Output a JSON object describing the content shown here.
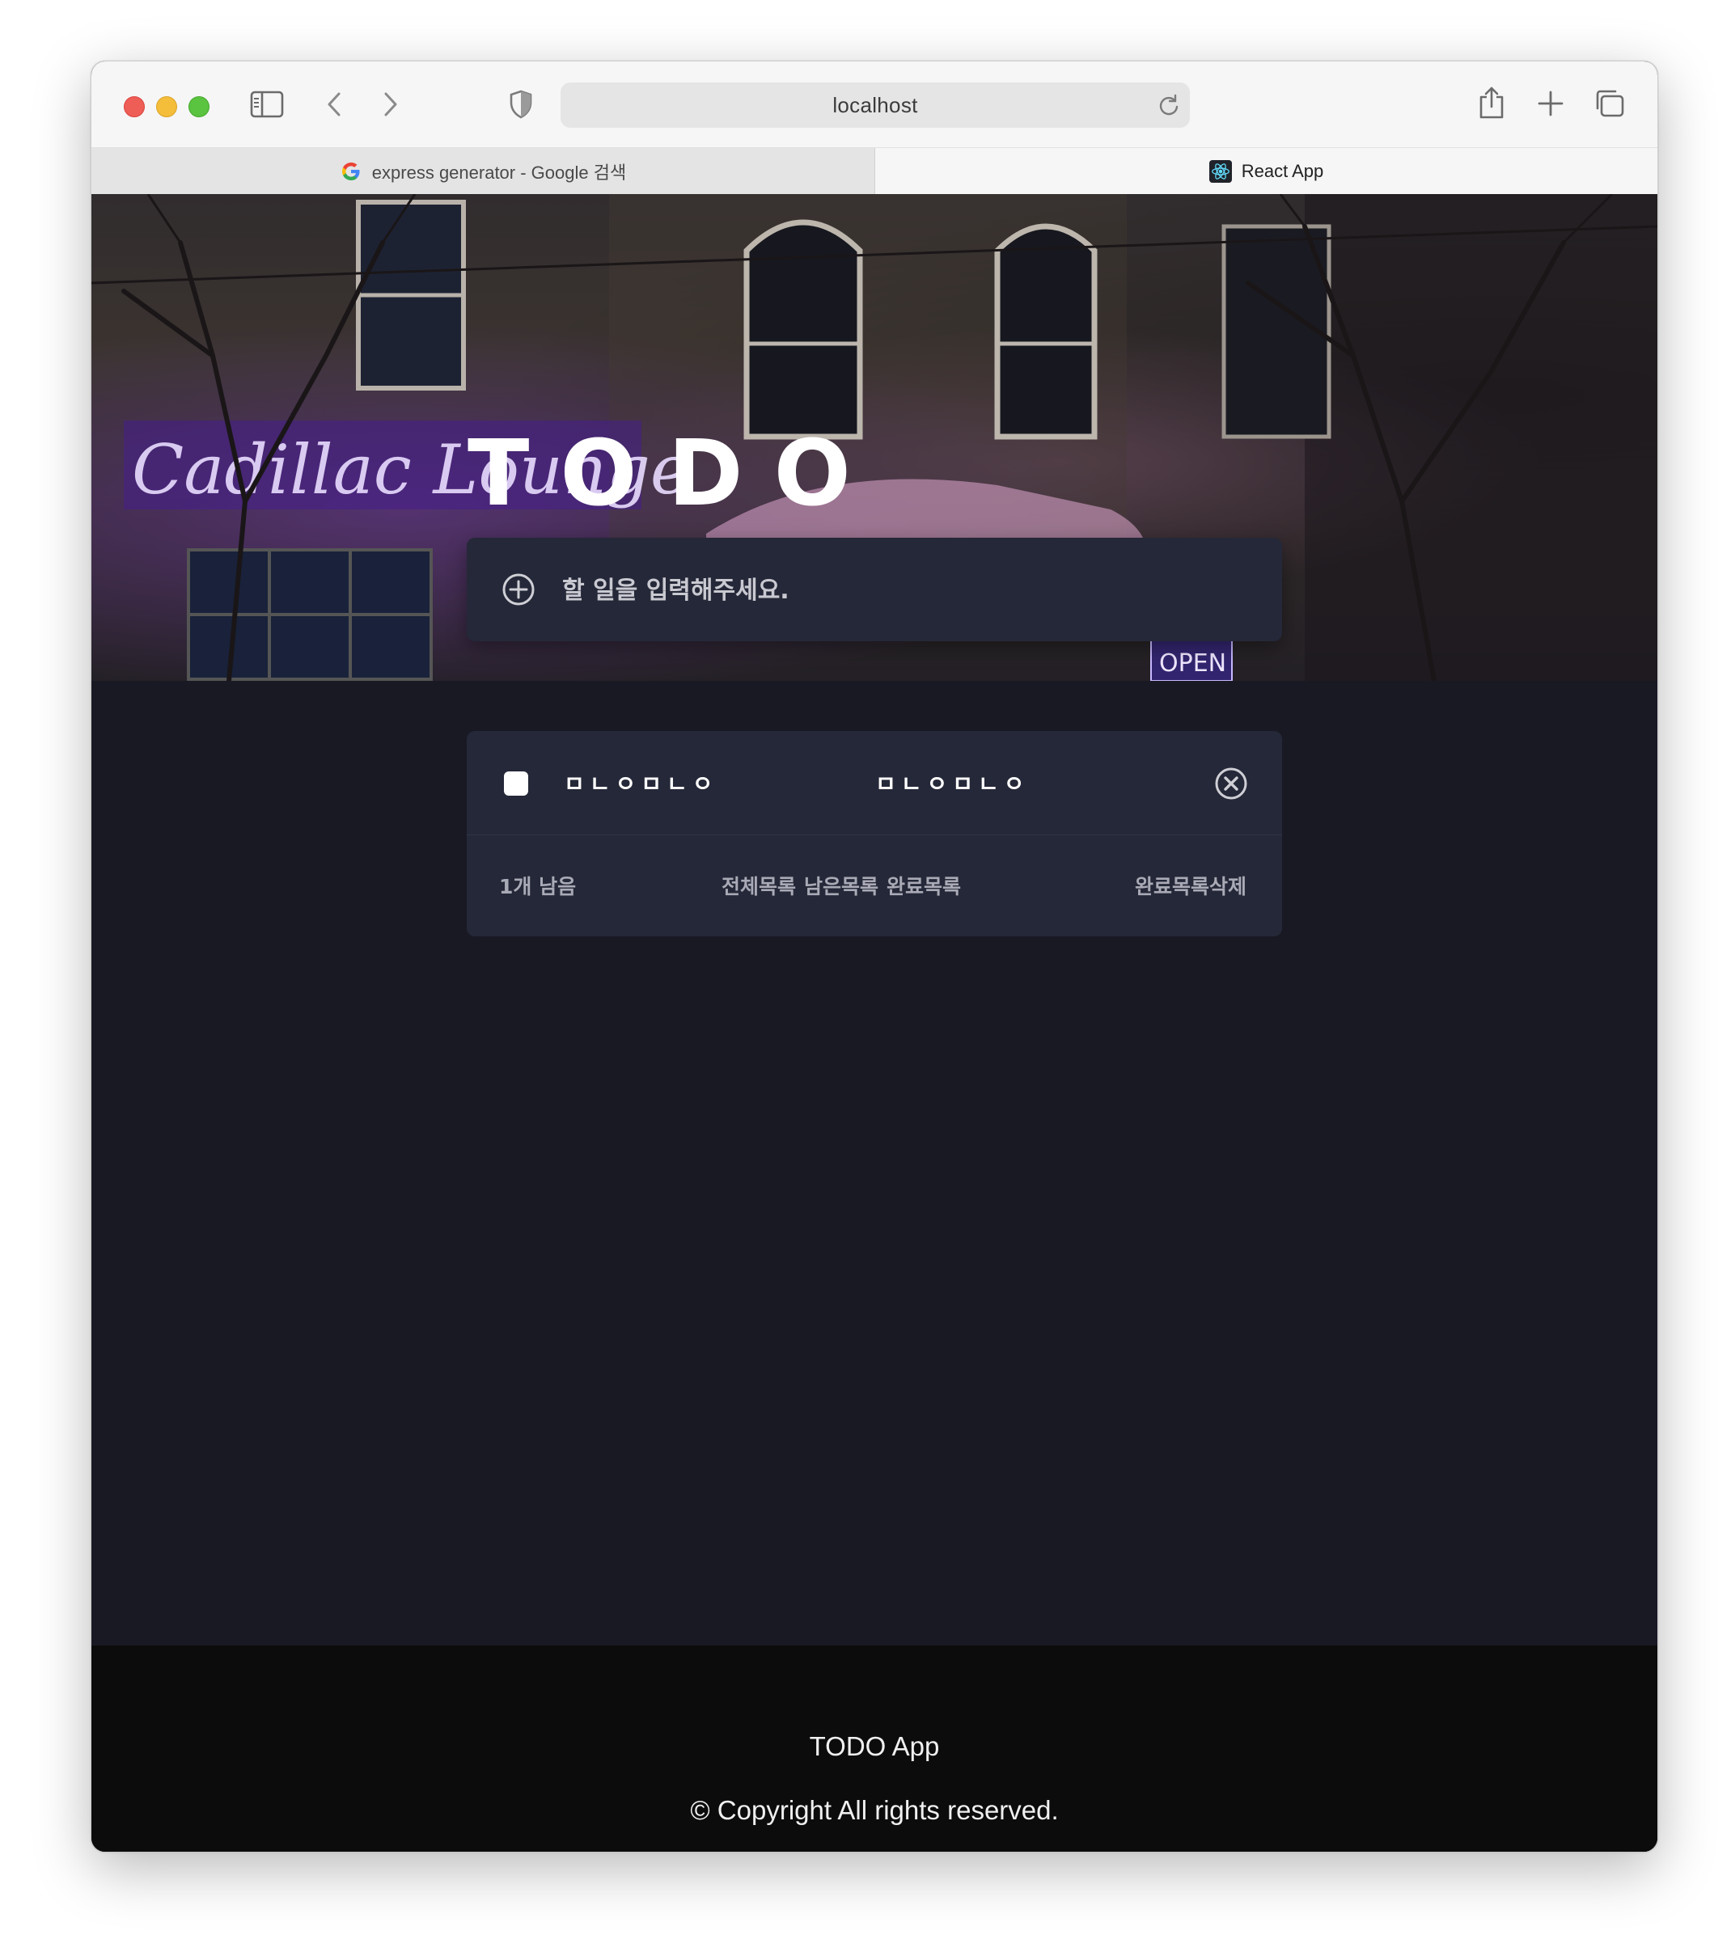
{
  "browser": {
    "url": "localhost",
    "tabs": [
      {
        "label": "express generator - Google 검색",
        "favicon": "google-icon",
        "active": false
      },
      {
        "label": "React App",
        "favicon": "react-icon",
        "active": true
      }
    ]
  },
  "hero": {
    "title": "TODO",
    "input_placeholder": "할 일을 입력해주세요."
  },
  "todos": [
    {
      "text_1": "ㅁㄴㅇㅁㄴㅇ",
      "text_2": "ㅁㄴㅇㅁㄴㅇ",
      "done": false
    }
  ],
  "list_footer": {
    "remaining": "1개 남음",
    "filter_all": "전체목록",
    "filter_active": "남은목록",
    "filter_done": "완료목록",
    "clear_done": "완료목록삭제"
  },
  "site_footer": {
    "title": "TODO App",
    "copyright": "© Copyright All rights reserved."
  },
  "colors": {
    "page_bg": "#181923",
    "card_bg": "#252838",
    "footer_bg": "#0c0c0d",
    "text_muted": "#a9aab6"
  }
}
